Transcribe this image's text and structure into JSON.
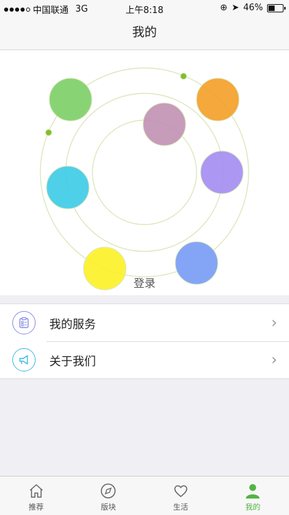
{
  "status": {
    "carrier": "中国联通",
    "network": "3G",
    "time": "上午8:18",
    "battery": "46%",
    "battery_level": 0.46
  },
  "nav": {
    "title": "我的"
  },
  "hero": {
    "login_label": "登录",
    "bubbles": [
      {
        "name": "green",
        "color": "#7ed16a"
      },
      {
        "name": "orange",
        "color": "#f5a12b"
      },
      {
        "name": "mauve",
        "color": "#c393b5"
      },
      {
        "name": "purple",
        "color": "#a68ff2"
      },
      {
        "name": "cyan",
        "color": "#3fcde8"
      },
      {
        "name": "blue",
        "color": "#7a9ef5"
      },
      {
        "name": "yellow",
        "color": "#fdf12a"
      }
    ],
    "orbit_color": "#d7e4b6",
    "dot_color": "#7fbf2e"
  },
  "menu": {
    "items": [
      {
        "label": "我的服务",
        "icon": "clipboard-icon",
        "icon_color": "#8a8fe0"
      },
      {
        "label": "关于我们",
        "icon": "megaphone-icon",
        "icon_color": "#3fb9e3"
      }
    ]
  },
  "tabs": [
    {
      "label": "推荐",
      "icon": "home-icon",
      "active": false
    },
    {
      "label": "版块",
      "icon": "compass-icon",
      "active": false
    },
    {
      "label": "生活",
      "icon": "heart-icon",
      "active": false
    },
    {
      "label": "我的",
      "icon": "person-icon",
      "active": true
    }
  ],
  "colors": {
    "accent": "#52b442"
  }
}
